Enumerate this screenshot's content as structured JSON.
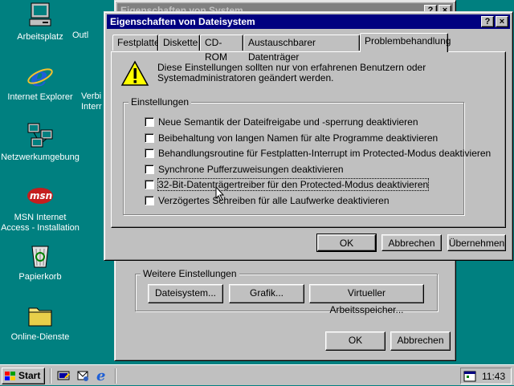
{
  "desktop": {
    "icons": [
      {
        "label": "Arbeitsplatz"
      },
      {
        "label": "Internet Explorer"
      },
      {
        "label": "Netzwerkumgebung"
      },
      {
        "label": "MSN Internet Access - Installation"
      },
      {
        "label": "Papierkorb"
      },
      {
        "label": "Online-Dienste"
      }
    ],
    "partial_icons": [
      {
        "label": "Outl"
      },
      {
        "label": "Verbi"
      },
      {
        "label": "Interr"
      }
    ]
  },
  "system_props": {
    "title": "Eigenschaften von System",
    "group_title": "Weitere Einstellungen",
    "buttons": [
      "Dateisystem...",
      "Grafik...",
      "Virtueller Arbeitsspeicher..."
    ],
    "ok_label": "OK",
    "cancel_label": "Abbrechen"
  },
  "dialog": {
    "title": "Eigenschaften von Dateisystem",
    "help_btn": "?",
    "close_btn": "×",
    "tabs": [
      "Festplatte",
      "Diskette",
      "CD-ROM",
      "Austauschbarer Datenträger",
      "Problembehandlung"
    ],
    "selected_tab": "Problembehandlung",
    "warning_line1": "Diese Einstellungen sollten nur von erfahrenen Benutzern oder",
    "warning_line2": "Systemadministratoren geändert werden.",
    "group_title": "Einstellungen",
    "options": [
      {
        "label": "Neue Semantik der Dateifreigabe und -sperrung deaktivieren",
        "checked": false
      },
      {
        "label": "Beibehaltung von langen Namen für alte Programme deaktivieren",
        "checked": false
      },
      {
        "label": "Behandlungsroutine für Festplatten-Interrupt im Protected-Modus deaktivieren",
        "checked": false
      },
      {
        "label": "Synchrone Pufferzuweisungen deaktivieren",
        "checked": false
      },
      {
        "label": "32-Bit-Datenträgertreiber für den Protected-Modus deaktivieren",
        "checked": false
      },
      {
        "label": "Verzögertes Schreiben für alle Laufwerke deaktivieren",
        "checked": false
      }
    ],
    "ok_label": "OK",
    "cancel_label": "Abbrechen",
    "apply_label": "Übernehmen"
  },
  "taskbar": {
    "start_label": "Start",
    "clock": "11:43"
  }
}
